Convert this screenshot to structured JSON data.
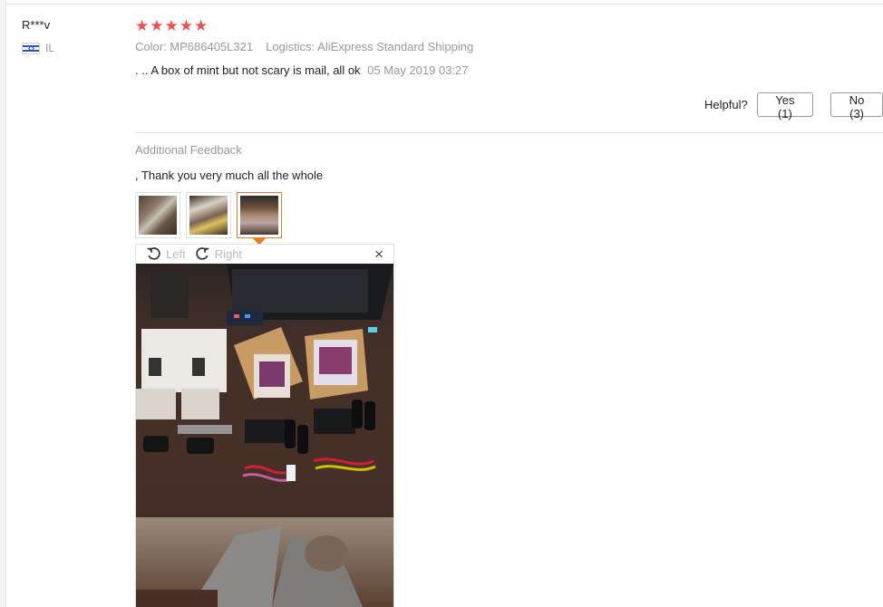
{
  "reviewer": {
    "name": "R***v",
    "country": "IL"
  },
  "rating": {
    "stars": 5,
    "max": 5,
    "color": "#f0504d"
  },
  "meta": {
    "color": "Color: MP686405L321",
    "logistics": "Logistics: AliExpress Standard Shipping"
  },
  "review": {
    "text": ". .. A box of mint but not scary is mail, all ok",
    "date": "05 May 2019 03:27"
  },
  "helpful": {
    "label": "Helpful?",
    "yes_label": "Yes (1)",
    "no_label": "No (3)"
  },
  "additional": {
    "title": "Additional Feedback",
    "text": ", Thank you very much all the whole"
  },
  "thumbnails": {
    "count": 3,
    "active_index": 2,
    "accent": "#e87b2c"
  },
  "viewer": {
    "rotate_left": "Left",
    "rotate_right": "Right",
    "close": "×"
  }
}
